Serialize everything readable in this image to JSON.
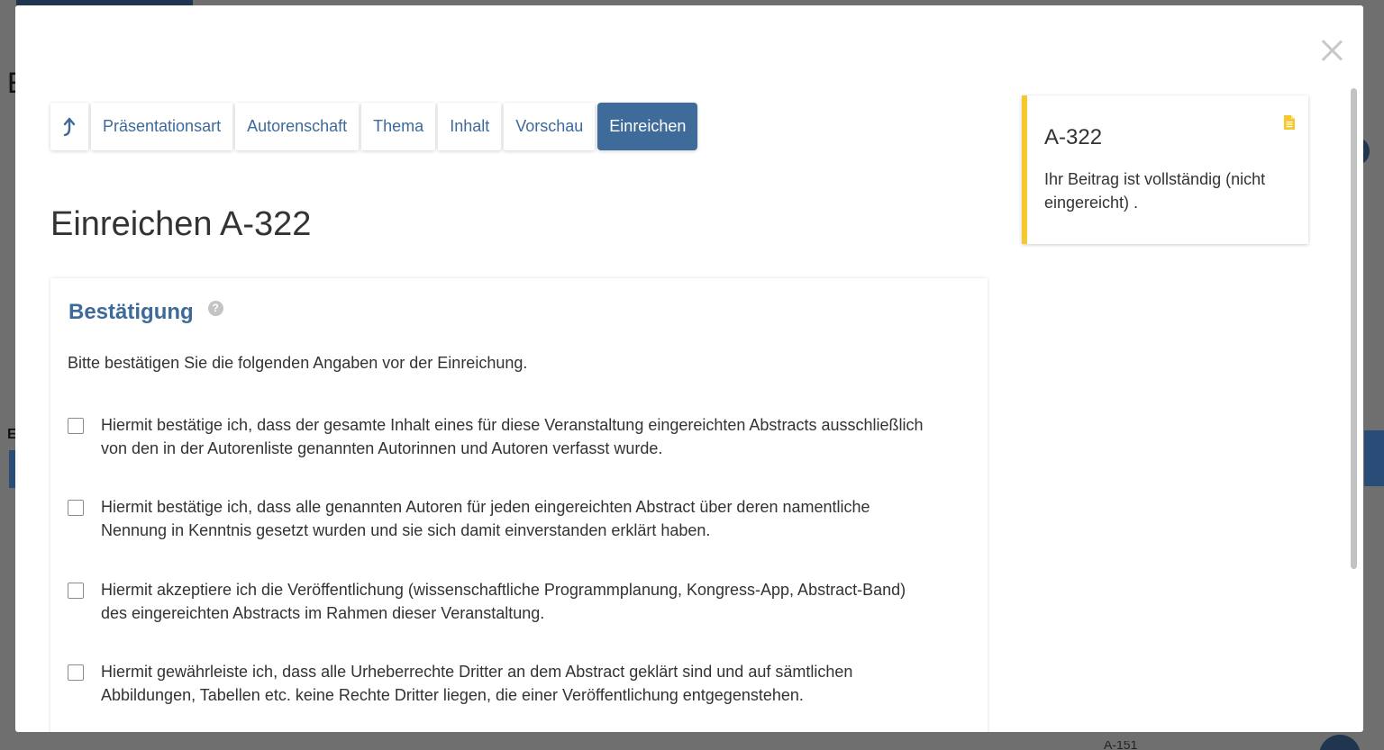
{
  "background": {
    "row_id": "A-151"
  },
  "tabs": [
    {
      "label": "",
      "icon": "arrow-up-icon"
    },
    {
      "label": "Präsentationsart"
    },
    {
      "label": "Autorenschaft"
    },
    {
      "label": "Thema"
    },
    {
      "label": "Inhalt"
    },
    {
      "label": "Vorschau"
    },
    {
      "label": "Einreichen",
      "active": true
    }
  ],
  "page_title": "Einreichen A-322",
  "confirmation": {
    "title": "Bestätigung",
    "help": "?",
    "intro": "Bitte bestätigen Sie die folgenden Angaben vor der Einreichung.",
    "items": [
      {
        "text": "Hiermit bestätige ich, dass der gesamte Inhalt eines für diese Veranstaltung eingereichten Abstracts ausschließlich von den in der Autorenliste genannten Autorinnen und Autoren verfasst wurde.",
        "checked": false
      },
      {
        "text": "Hiermit bestätige ich, dass alle genannten Autoren für jeden eingereichten Abstract über deren namentliche Nennung in Kenntnis gesetzt wurden und sie sich damit einverstanden erklärt haben.",
        "checked": false
      },
      {
        "text": "Hiermit akzeptiere ich die Veröffentlichung (wissenschaftliche Programmplanung, Kongress-App, Abstract-Band) des eingereichten Abstracts im Rahmen dieser Veranstaltung.",
        "checked": false
      },
      {
        "text": "Hiermit gewährleiste ich, dass alle Urheberrechte Dritter an dem Abstract geklärt sind und auf sämtlichen Abbildungen, Tabellen etc. keine Rechte Dritter liegen, die einer Veröffentlichung entgegenstehen.",
        "checked": false
      }
    ]
  },
  "status_card": {
    "id": "A-322",
    "message": "Ihr Beitrag ist vollständig (nicht eingereicht) .",
    "icon": "document-icon",
    "accent_color": "#f5c82e"
  },
  "colors": {
    "accent": "#3f6b9a",
    "link": "#3d6a9a",
    "overlay": "#6f6f6f"
  }
}
